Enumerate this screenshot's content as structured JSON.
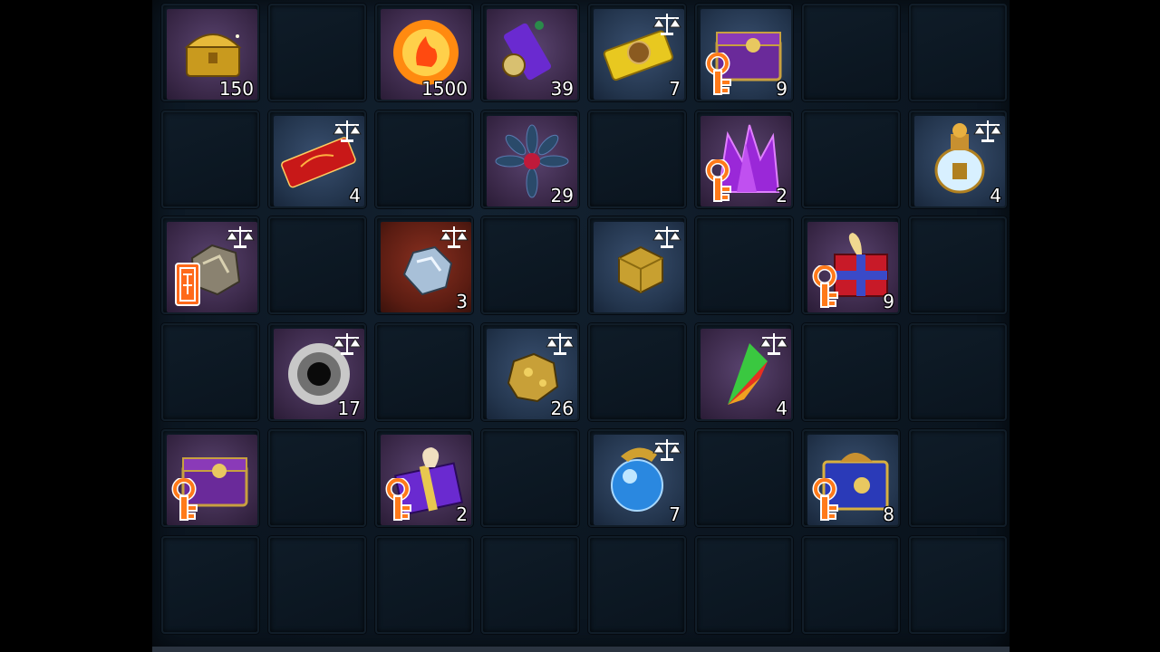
{
  "inventory": {
    "slots": [
      [
        {
          "icon": "gold-treasure-chest-icon",
          "bg": "purple",
          "qty": "150",
          "trade": false,
          "key": false,
          "bound": false
        },
        null,
        {
          "icon": "fire-orb-icon",
          "bg": "purple",
          "qty": "1500",
          "trade": false,
          "key": false,
          "bound": false
        },
        {
          "icon": "purple-charm-talisman-icon",
          "bg": "purple",
          "qty": "39",
          "trade": false,
          "key": false,
          "bound": false
        },
        {
          "icon": "gold-charm-talisman-icon",
          "bg": "blue",
          "qty": "7",
          "trade": true,
          "key": false,
          "bound": false
        },
        {
          "icon": "purple-locked-chest-icon",
          "bg": "blue",
          "qty": "9",
          "trade": false,
          "key": true,
          "bound": false
        },
        null,
        null
      ],
      [
        null,
        {
          "icon": "red-talisman-icon",
          "bg": "blue",
          "qty": "4",
          "trade": true,
          "key": false,
          "bound": false
        },
        null,
        {
          "icon": "dark-flower-core-icon",
          "bg": "purple",
          "qty": "29",
          "trade": false,
          "key": false,
          "bound": false
        },
        null,
        {
          "icon": "purple-crystal-cluster-icon",
          "bg": "purple",
          "qty": "2",
          "trade": false,
          "key": true,
          "bound": false
        },
        null,
        {
          "icon": "golden-potion-icon",
          "bg": "blue",
          "qty": "4",
          "trade": true,
          "key": false,
          "bound": false
        }
      ],
      [
        {
          "icon": "silver-ore-icon",
          "bg": "purple",
          "qty": "",
          "trade": true,
          "key": false,
          "bound": true
        },
        null,
        {
          "icon": "moonstone-icon",
          "bg": "red",
          "qty": "3",
          "trade": true,
          "key": false,
          "bound": false
        },
        null,
        {
          "icon": "gold-cube-icon",
          "bg": "blue",
          "qty": "",
          "trade": true,
          "key": false,
          "bound": false
        },
        null,
        {
          "icon": "red-gift-box-icon",
          "bg": "purple",
          "qty": "9",
          "trade": false,
          "key": true,
          "bound": false
        },
        null
      ],
      [
        null,
        {
          "icon": "dark-vortex-orb-icon",
          "bg": "purple",
          "qty": "17",
          "trade": true,
          "key": false,
          "bound": false
        },
        null,
        {
          "icon": "gold-nugget-icon",
          "bg": "blue",
          "qty": "26",
          "trade": true,
          "key": false,
          "bound": false
        },
        null,
        {
          "icon": "rainbow-crystal-shard-icon",
          "bg": "purple",
          "qty": "4",
          "trade": true,
          "key": false,
          "bound": false
        },
        null,
        null
      ],
      [
        {
          "icon": "purple-locked-chest-icon",
          "bg": "purple",
          "qty": "",
          "trade": false,
          "key": true,
          "bound": false
        },
        null,
        {
          "icon": "purple-gift-box-icon",
          "bg": "purple",
          "qty": "2",
          "trade": false,
          "key": true,
          "bound": false
        },
        null,
        {
          "icon": "dragon-crystal-ball-icon",
          "bg": "blue",
          "qty": "7",
          "trade": true,
          "key": false,
          "bound": false
        },
        null,
        {
          "icon": "blue-dragon-chest-icon",
          "bg": "blue",
          "qty": "8",
          "trade": false,
          "key": true,
          "bound": false
        },
        null
      ],
      [
        null,
        null,
        null,
        null,
        null,
        null,
        null,
        null
      ]
    ]
  },
  "colors": {
    "slot_border": "#111d28",
    "key_badge": "#ff7a1a",
    "quantity_text": "#ffffff"
  }
}
